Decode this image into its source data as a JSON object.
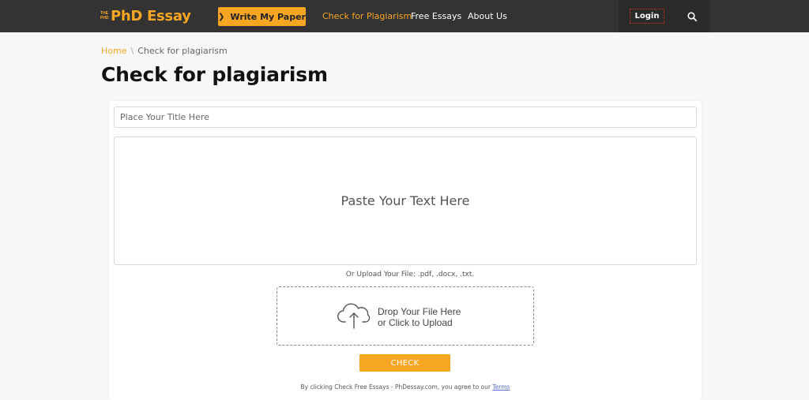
{
  "header": {
    "logo_small_top": "THE",
    "logo_small_bottom": "PHD",
    "logo_text": "PhD Essay",
    "write_button": "Write My Paper",
    "nav": [
      "Check for Plagiarism",
      "Free Essays",
      "About Us"
    ],
    "login": "Login"
  },
  "breadcrumb": {
    "home": "Home",
    "separator": "\\",
    "current": "Check for plagiarism"
  },
  "page_title": "Check for plagiarism",
  "form": {
    "title_placeholder": "Place Your Title Here",
    "text_placeholder": "Paste Your Text Here",
    "upload_hint": "Or Upload Your File: .pdf, .docx, .txt.",
    "drop_line1": "Drop Your File Here",
    "drop_line2": "or Click to Upload",
    "check_button": "CHECK",
    "terms_text": "By clicking Check Free Essays - PhDessay.com, you agree to our",
    "terms_link": "Terms"
  },
  "colors": {
    "accent": "#f6a623",
    "header_bg": "#333333",
    "link": "#4a6fd8"
  },
  "icons": {
    "write_chevron": "chevron-right-icon",
    "search": "search-icon",
    "upload": "cloud-upload-icon"
  }
}
